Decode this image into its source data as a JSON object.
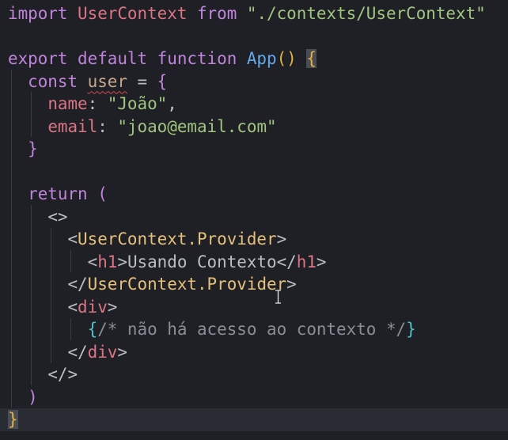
{
  "editor": {
    "language": "jsx",
    "current_line": 19,
    "lines": [
      [
        [
          "import ",
          "kw"
        ],
        [
          "UserContext",
          "cls"
        ],
        [
          " from ",
          "kw"
        ],
        [
          "\"./contexts/UserContext\"",
          "str"
        ]
      ],
      [],
      [
        [
          "export default function ",
          "kw"
        ],
        [
          "App",
          "fn"
        ],
        [
          "()",
          "br1"
        ],
        [
          " ",
          "punct"
        ],
        [
          "{",
          "br1 hl"
        ]
      ],
      [
        [
          "  ",
          "punct"
        ],
        [
          "const ",
          "kw"
        ],
        [
          "user",
          "var"
        ],
        [
          " = ",
          "punct"
        ],
        [
          "{",
          "br2"
        ]
      ],
      [
        [
          "    ",
          "punct"
        ],
        [
          "name",
          "prop"
        ],
        [
          ": ",
          "punct"
        ],
        [
          "\"João\"",
          "str"
        ],
        [
          ",",
          "punct"
        ]
      ],
      [
        [
          "    ",
          "punct"
        ],
        [
          "email",
          "prop"
        ],
        [
          ": ",
          "punct"
        ],
        [
          "\"joao@email.com\"",
          "str"
        ]
      ],
      [
        [
          "  ",
          "punct"
        ],
        [
          "}",
          "br2"
        ]
      ],
      [],
      [
        [
          "  ",
          "punct"
        ],
        [
          "return ",
          "kw"
        ],
        [
          "(",
          "br2"
        ]
      ],
      [
        [
          "    ",
          "punct"
        ],
        [
          "<>",
          "punct"
        ]
      ],
      [
        [
          "      ",
          "punct"
        ],
        [
          "<",
          "punct"
        ],
        [
          "UserContext.Provider",
          "tagc"
        ],
        [
          ">",
          "punct"
        ]
      ],
      [
        [
          "        ",
          "punct"
        ],
        [
          "<",
          "punct"
        ],
        [
          "h1",
          "tag"
        ],
        [
          ">",
          "punct"
        ],
        [
          "Usando Contexto",
          "punct"
        ],
        [
          "</",
          "punct"
        ],
        [
          "h1",
          "tag"
        ],
        [
          ">",
          "punct"
        ]
      ],
      [
        [
          "      ",
          "punct"
        ],
        [
          "</",
          "punct"
        ],
        [
          "UserContext.Provider",
          "tagc"
        ],
        [
          ">",
          "punct"
        ]
      ],
      [
        [
          "      ",
          "punct"
        ],
        [
          "<",
          "punct"
        ],
        [
          "div",
          "tag"
        ],
        [
          ">",
          "punct"
        ]
      ],
      [
        [
          "        ",
          "punct"
        ],
        [
          "{",
          "jsx"
        ],
        [
          "/* não há acesso ao contexto */",
          "cmt"
        ],
        [
          "}",
          "jsx"
        ]
      ],
      [
        [
          "      ",
          "punct"
        ],
        [
          "</",
          "punct"
        ],
        [
          "div",
          "tag"
        ],
        [
          ">",
          "punct"
        ]
      ],
      [
        [
          "    ",
          "punct"
        ],
        [
          "</>",
          "punct"
        ]
      ],
      [
        [
          "  ",
          "punct"
        ],
        [
          ")",
          "br2"
        ]
      ],
      [
        [
          "}",
          "br1 hl"
        ]
      ]
    ]
  }
}
